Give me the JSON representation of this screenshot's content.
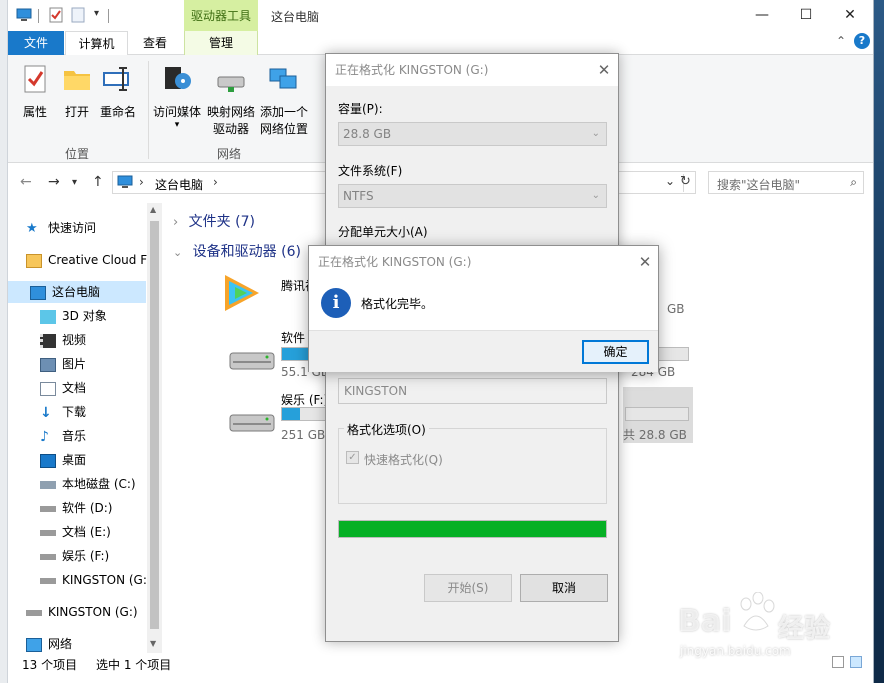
{
  "titlebar": {
    "context_tab_header": "驱动器工具",
    "window_title": "这台电脑",
    "minimize": "—",
    "maximize": "☐",
    "close": "✕"
  },
  "tabs": [
    {
      "label": "文件"
    },
    {
      "label": "计算机"
    },
    {
      "label": "查看"
    },
    {
      "label": "管理"
    }
  ],
  "ribbon": {
    "properties": "属性",
    "open": "打开",
    "rename": "重命名",
    "access_media": "访问媒体",
    "map_drive_1": "映射网络",
    "map_drive_2": "驱动器",
    "add_network_1": "添加一个",
    "add_network_2": "网络位置",
    "group_location": "位置",
    "group_network": "网络"
  },
  "address": {
    "path": "这台电脑",
    "search_placeholder": "搜索\"这台电脑\""
  },
  "navpane": {
    "items": [
      {
        "label": "快速访问"
      },
      {
        "label": "Creative Cloud F"
      },
      {
        "label": "这台电脑"
      },
      {
        "label": "3D 对象"
      },
      {
        "label": "视频"
      },
      {
        "label": "图片"
      },
      {
        "label": "文档"
      },
      {
        "label": "下载"
      },
      {
        "label": "音乐"
      },
      {
        "label": "桌面"
      },
      {
        "label": "本地磁盘 (C:)"
      },
      {
        "label": "软件 (D:)"
      },
      {
        "label": "文档 (E:)"
      },
      {
        "label": "娱乐 (F:)"
      },
      {
        "label": "KINGSTON (G:"
      },
      {
        "label": "KINGSTON (G:)"
      },
      {
        "label": "网络"
      }
    ]
  },
  "content": {
    "folders_header": "文件夹 (7)",
    "devices_header": "设备和驱动器 (6)",
    "drives": [
      {
        "name": "腾讯视",
        "size": "GB"
      },
      {
        "name": "软件 (D",
        "free": "55.1 GB",
        "size": "284 GB"
      },
      {
        "name": "娱乐 (F:)",
        "free": "251 GB 可",
        "size": "共 28.8 GB"
      }
    ]
  },
  "status": {
    "count": "13 个项目",
    "selected": "选中 1 个项目"
  },
  "format_dialog": {
    "title": "正在格式化 KINGSTON (G:)",
    "capacity_label": "容量(P):",
    "capacity_value": "28.8 GB",
    "fs_label": "文件系统(F)",
    "fs_value": "NTFS",
    "alloc_label": "分配单元大小(A)",
    "volume_value": "KINGSTON",
    "options_label": "格式化选项(O)",
    "quick_format": "快速格式化(Q)",
    "progress": 1.0,
    "start_button": "开始(S)",
    "cancel_button": "取消"
  },
  "message_box": {
    "title": "正在格式化 KINGSTON (G:)",
    "message": "格式化完毕。",
    "ok_button": "确定"
  },
  "watermark": {
    "brand": "Bai",
    "brand2": "经验",
    "url": "jingyan.baidu.com"
  },
  "colors": {
    "accent": "#1979ca",
    "progress_green": "#06b025",
    "selection": "#cce8ff"
  }
}
